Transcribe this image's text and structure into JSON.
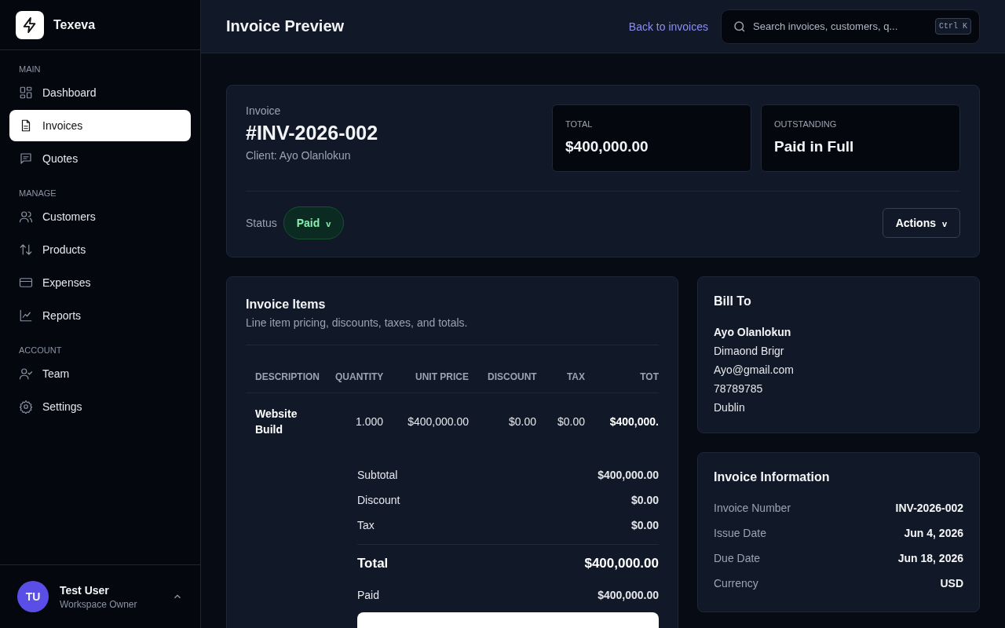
{
  "brand": {
    "name": "Texeva"
  },
  "sidebar": {
    "sections": [
      {
        "heading": "MAIN",
        "items": [
          {
            "label": "Dashboard",
            "kind": "grid",
            "selected": false
          },
          {
            "label": "Invoices",
            "kind": "doc",
            "selected": true
          },
          {
            "label": "Quotes",
            "kind": "chat",
            "selected": false
          }
        ]
      },
      {
        "heading": "MANAGE",
        "items": [
          {
            "label": "Customers",
            "kind": "users",
            "selected": false
          },
          {
            "label": "Products",
            "kind": "arrows",
            "selected": false
          },
          {
            "label": "Expenses",
            "kind": "card",
            "selected": false
          },
          {
            "label": "Reports",
            "kind": "chart",
            "selected": false
          }
        ]
      },
      {
        "heading": "ACCOUNT",
        "items": [
          {
            "label": "Team",
            "kind": "usercheck",
            "selected": false
          },
          {
            "label": "Settings",
            "kind": "gear",
            "selected": false
          }
        ]
      }
    ],
    "user": {
      "initials": "TU",
      "name": "Test User",
      "role": "Workspace Owner"
    }
  },
  "header": {
    "title": "Invoice Preview",
    "back_link": "Back to invoices",
    "search": {
      "placeholder": "Search invoices, customers, q...",
      "shortcut": "Ctrl K"
    }
  },
  "invoice": {
    "label": "Invoice",
    "number": "#INV-2026-002",
    "client": "Client: Ayo Olanlokun",
    "stats": [
      {
        "label": "TOTAL",
        "value": "$400,000.00"
      },
      {
        "label": "OUTSTANDING",
        "value": "Paid in Full"
      }
    ],
    "status_label": "Status",
    "status": {
      "text": "Paid",
      "caret": "v"
    },
    "actions": {
      "text": "Actions",
      "caret": "v"
    }
  },
  "items": {
    "title": "Invoice Items",
    "subtitle": "Line item pricing, discounts, taxes, and totals.",
    "columns": [
      "DESCRIPTION",
      "QUANTITY",
      "UNIT PRICE",
      "DISCOUNT",
      "TAX",
      "TOT"
    ],
    "rows": [
      [
        "Website Build",
        "1.000",
        "$400,000.00",
        "$0.00",
        "$0.00",
        "$400,000."
      ]
    ],
    "totals": [
      {
        "label": "Subtotal",
        "value": "$400,000.00",
        "kind": "plain"
      },
      {
        "label": "Discount",
        "value": "$0.00",
        "kind": "plain"
      },
      {
        "label": "Tax",
        "value": "$0.00",
        "kind": "plain"
      },
      {
        "label": "Total",
        "value": "$400,000.00",
        "kind": "grand"
      },
      {
        "label": "Paid",
        "value": "$400,000.00",
        "kind": "plain"
      }
    ]
  },
  "bill_to": {
    "title": "Bill To",
    "name": "Ayo Olanlokun",
    "lines": [
      "Dimaond Brigr",
      "Ayo@gmail.com",
      "78789785",
      "Dublin"
    ]
  },
  "info": {
    "title": "Invoice Information",
    "rows": [
      {
        "label": "Invoice Number",
        "value": "INV-2026-002"
      },
      {
        "label": "Issue Date",
        "value": "Jun 4, 2026"
      },
      {
        "label": "Due Date",
        "value": "Jun 18, 2026"
      },
      {
        "label": "Currency",
        "value": "USD"
      }
    ]
  }
}
